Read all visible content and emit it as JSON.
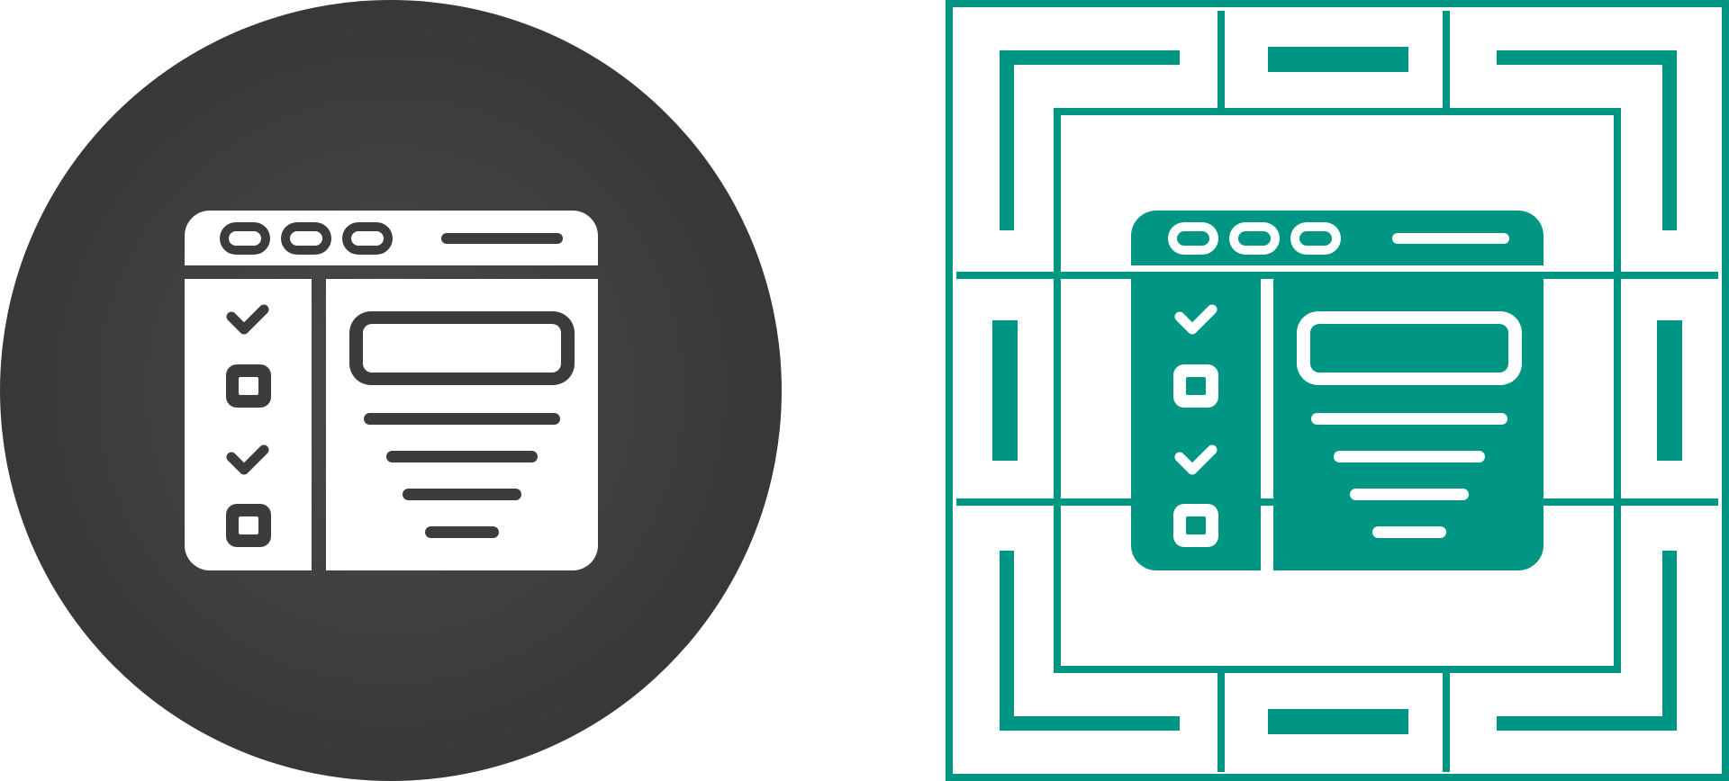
{
  "colors": {
    "background": "#ffffff",
    "dark_circle": "#3c3c3c",
    "dark_circle_highlight": "#4a4a4a",
    "dark_icon_fill": "#ffffff",
    "dark_icon_stroke": "#3c3c3c",
    "teal": "#009684",
    "teal_icon_stroke": "#ffffff"
  },
  "icons": {
    "left": "checklist-window-glyph-icon",
    "right": "checklist-window-teal-framed-icon"
  },
  "checklist": {
    "items": [
      "checked",
      "unchecked",
      "checked",
      "unchecked"
    ]
  },
  "window_buttons": 3,
  "content_lines": 4
}
